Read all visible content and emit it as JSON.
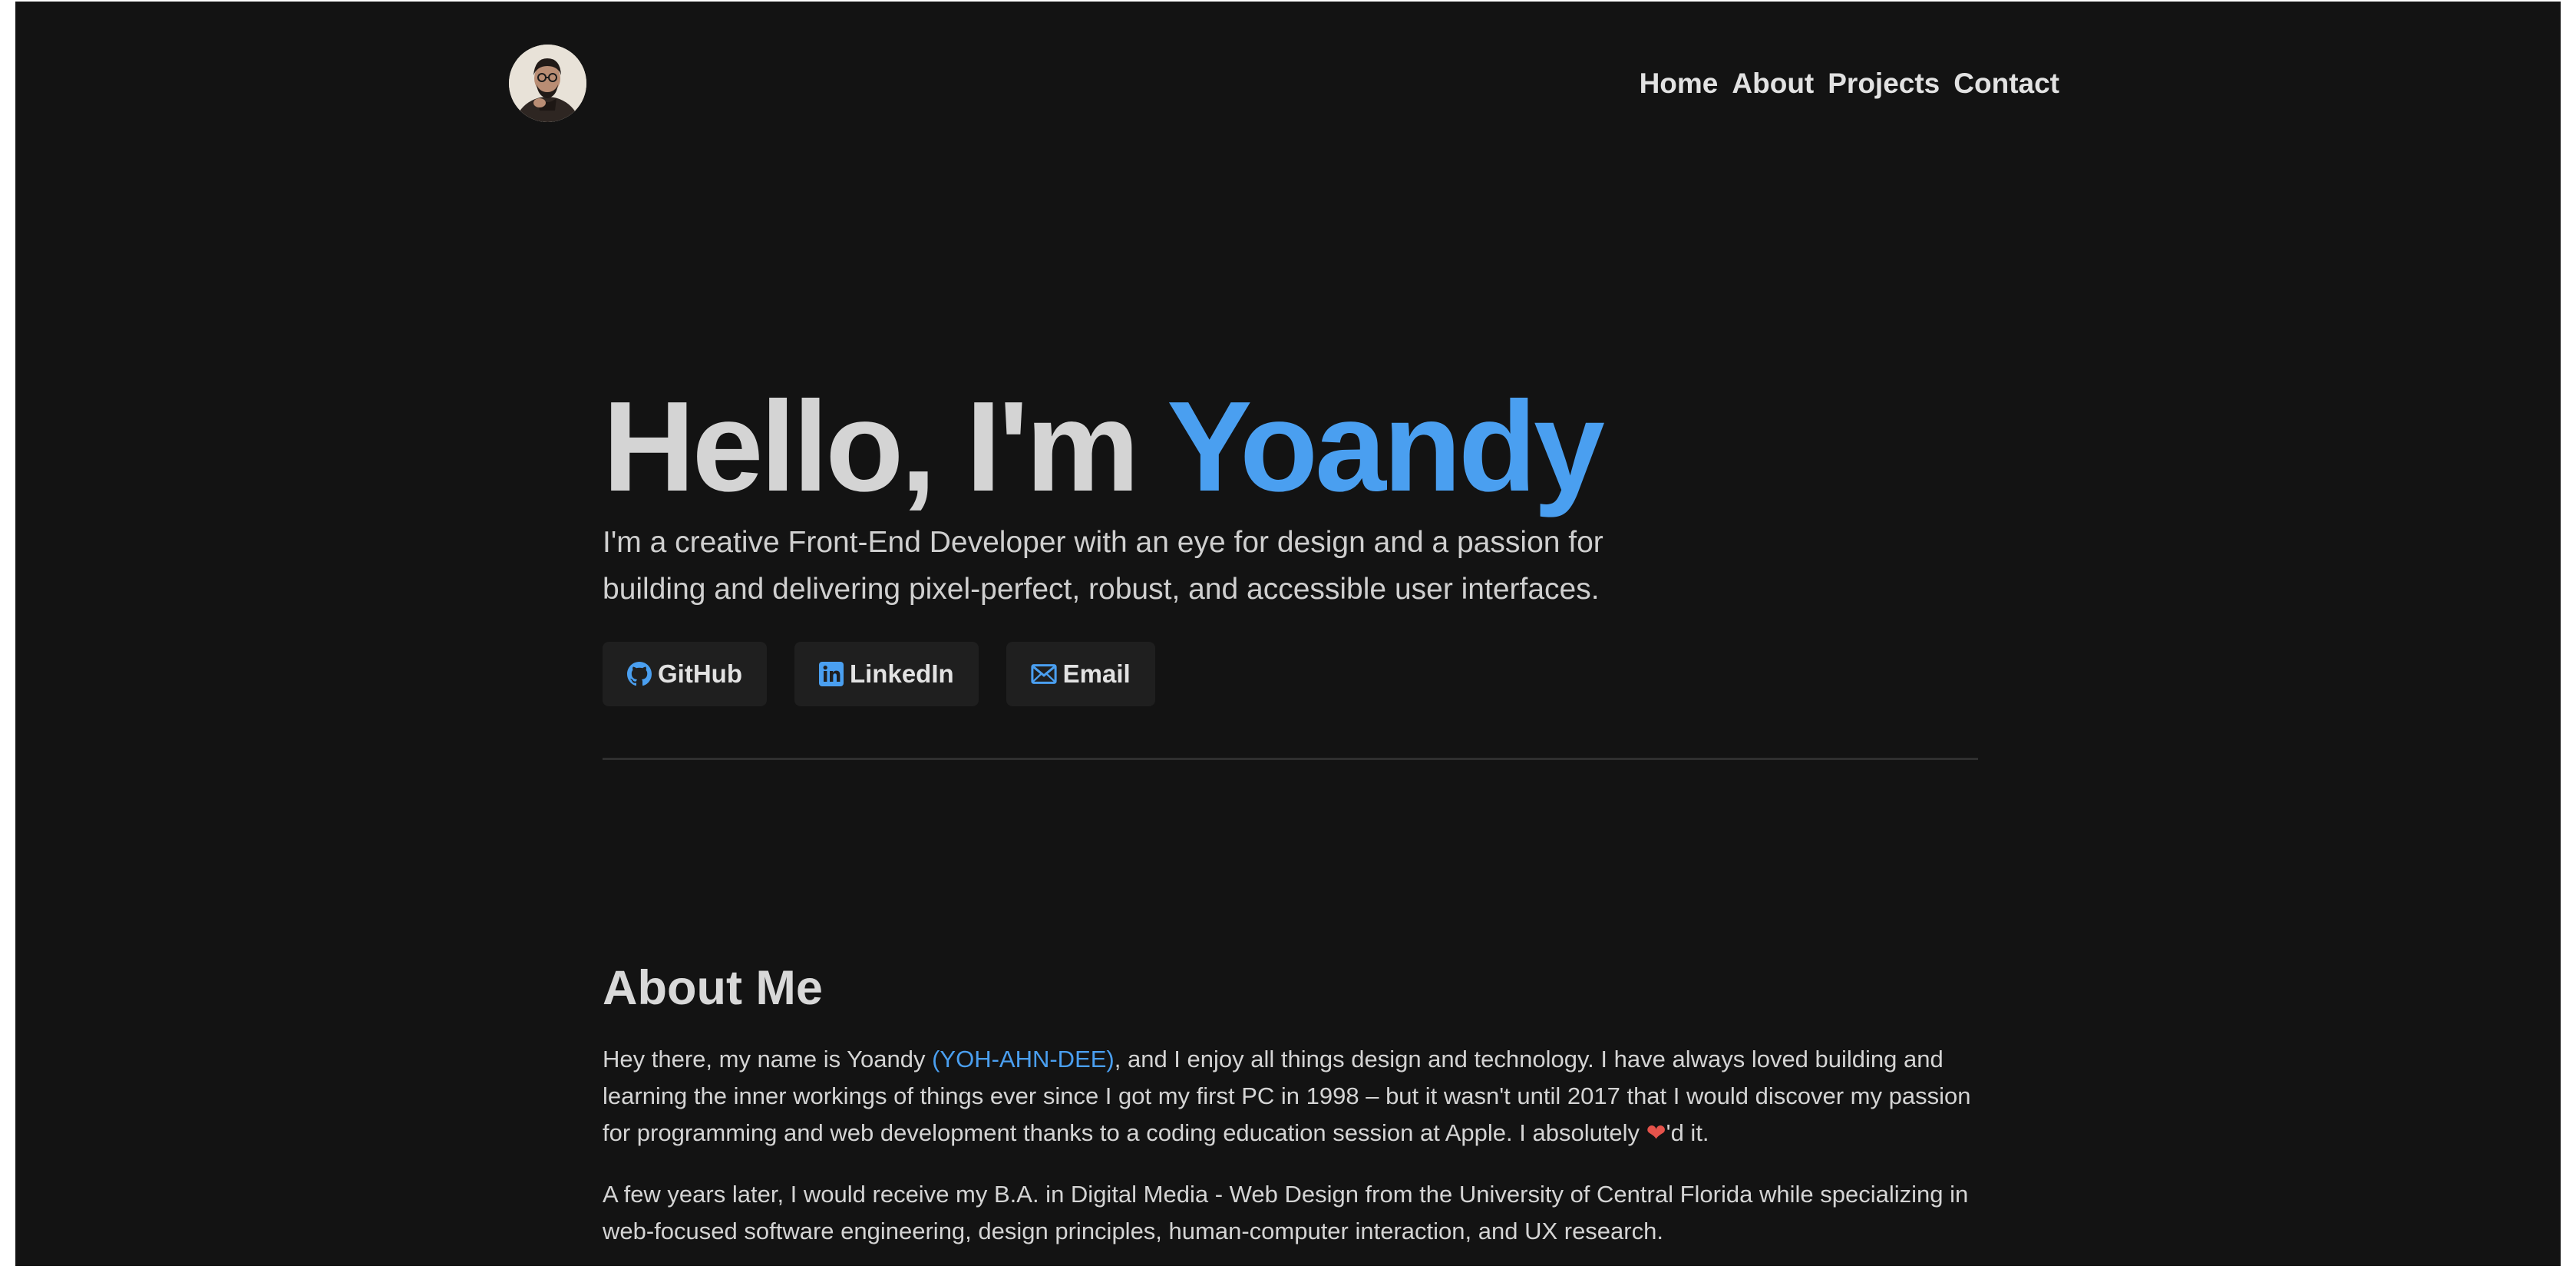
{
  "nav": {
    "items": [
      "Home",
      "About",
      "Projects",
      "Contact"
    ]
  },
  "hero": {
    "greeting": "Hello, I'm ",
    "name": "Yoandy",
    "subtitle": "I'm a creative Front-End Developer with an eye for design and a passion for building and delivering pixel-perfect, robust, and accessible user interfaces."
  },
  "socials": [
    {
      "label": "GitHub",
      "icon": "github-icon"
    },
    {
      "label": "LinkedIn",
      "icon": "linkedin-icon"
    },
    {
      "label": "Email",
      "icon": "mail-icon"
    }
  ],
  "about": {
    "title": "About Me",
    "p1_start": "Hey there, my name is Yoandy ",
    "pronunciation": "(YOH-AHN-DEE)",
    "p1_mid": ", and I enjoy all things design and technology. I have always loved building and learning the inner workings of things ever since I got my first PC in 1998 – but it wasn't until 2017 that I would discover my passion for programming and web development thanks to a coding education session at Apple. I absolutely ",
    "heart": "❤",
    "p1_end": "'d it.",
    "p2": "A few years later, I would receive my B.A. in Digital Media - Web Design from the University of Central Florida while specializing in web-focused software engineering, design principles, human-computer interaction, and UX research."
  },
  "colors": {
    "background": "#131313",
    "accent": "#4a9ff0",
    "text": "#d4d4d4",
    "button_bg": "#1f1f1f"
  }
}
